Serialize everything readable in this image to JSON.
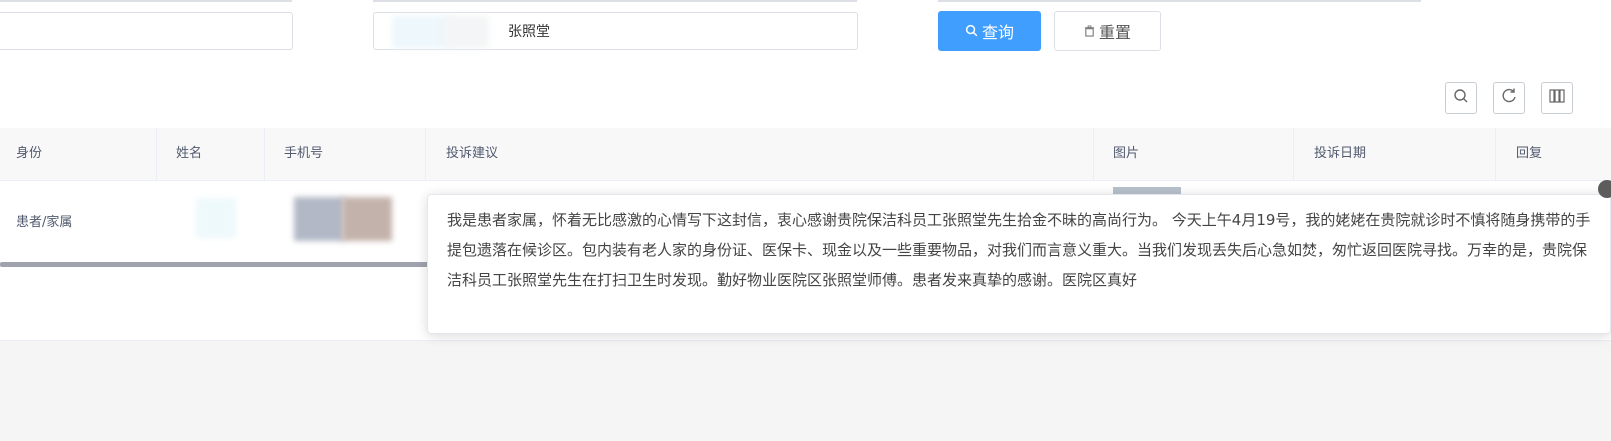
{
  "filters": {
    "name_value": "张照堂",
    "search_label": "查询",
    "reset_label": "重置"
  },
  "table": {
    "columns": [
      "身份",
      "姓名",
      "手机号",
      "投诉建议",
      "图片",
      "投诉日期",
      "回复"
    ],
    "rows": [
      {
        "identity": "患者/家属",
        "suggestion": "我是患者家属，怀着无比感激的心情写下这封信，衷心感谢贵院保洁科员工张照堂先生拾金不昧的高尚行为。 今天上午4月19号，我的姥姥在贵院就诊时不慎将随身携带的手提包遗落在候诊区。包内装有老人家的身份证、医保卡、现金以及一些重要物品，对我们而言意义重大。当我们发现丢失后心急如焚，匆忙返回医院寻找。万幸的是，贵院保洁科员工张照堂先生在打扫卫生时发现。勤好物业医院区张照堂师傅。患者发来真挚的感谢。医院区真好"
      }
    ]
  },
  "colors": {
    "primary": "#409eff",
    "header_bg": "#f8f8f9",
    "border": "#dcdfe6"
  },
  "icons": [
    "search-icon",
    "trash-icon",
    "zoom-icon",
    "refresh-icon",
    "columns-icon"
  ]
}
